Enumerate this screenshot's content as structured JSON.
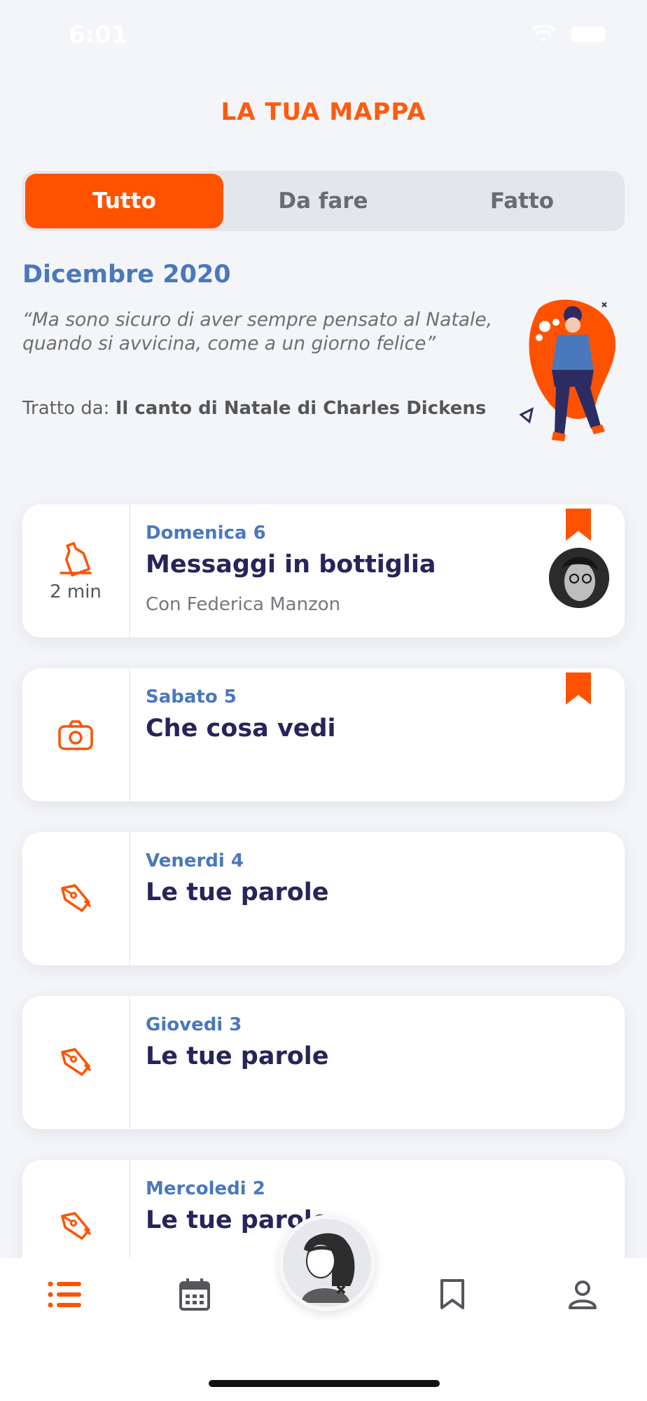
{
  "status_bar": {
    "time": "6:01"
  },
  "header": {
    "title": "LA TUA MAPPA"
  },
  "segments": [
    {
      "label": "Tutto",
      "active": true
    },
    {
      "label": "Da fare",
      "active": false
    },
    {
      "label": "Fatto",
      "active": false
    }
  ],
  "intro": {
    "month": "Dicembre 2020",
    "quote": "“Ma sono sicuro di aver sempre pensato al Natale, quando si avvicina, come a un giorno felice”",
    "source_prefix": "Tratto da: ",
    "source_title": "Il canto di Natale di Charles Dickens"
  },
  "cards": [
    {
      "day": "Domenica 6",
      "title": "Messaggi in bottiglia",
      "subtitle": "Con Federica Manzon",
      "duration": "2 min",
      "icon": "bottle-icon",
      "bookmarked": true,
      "has_avatar": true
    },
    {
      "day": "Sabato 5",
      "title": "Che cosa vedi",
      "subtitle": "",
      "duration": "",
      "icon": "camera-icon",
      "bookmarked": true,
      "has_avatar": false
    },
    {
      "day": "Venerdi 4",
      "title": "Le tue parole",
      "subtitle": "",
      "duration": "",
      "icon": "pen-icon",
      "bookmarked": false,
      "has_avatar": false
    },
    {
      "day": "Giovedi 3",
      "title": "Le tue parole",
      "subtitle": "",
      "duration": "",
      "icon": "pen-icon",
      "bookmarked": false,
      "has_avatar": false
    },
    {
      "day": "Mercoledi 2",
      "title": "Le tue parole",
      "subtitle": "",
      "duration": "",
      "icon": "pen-icon",
      "bookmarked": false,
      "has_avatar": false
    }
  ],
  "bottom_nav": [
    {
      "name": "list-icon",
      "active": true
    },
    {
      "name": "calendar-icon",
      "active": false
    },
    {
      "name": "character-avatar",
      "active": false
    },
    {
      "name": "bookmark-icon",
      "active": false
    },
    {
      "name": "profile-icon",
      "active": false
    }
  ],
  "colors": {
    "accent": "#ff5200",
    "blue": "#4a78bd",
    "navy": "#25255a",
    "background": "#f4f5f8"
  }
}
